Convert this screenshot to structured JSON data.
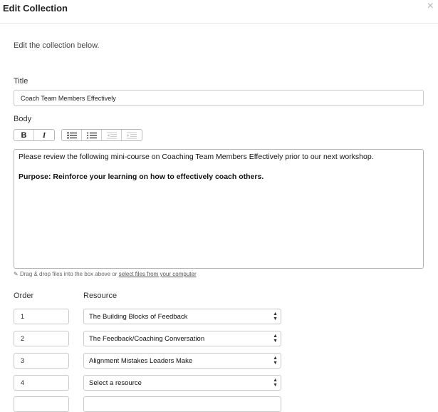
{
  "dialog": {
    "title": "Edit Collection",
    "close_icon": "×",
    "intro": "Edit the collection below."
  },
  "form": {
    "title_label": "Title",
    "title_value": "Coach Team Members Effectively",
    "body_label": "Body",
    "toolbar": {
      "bold_label": "B",
      "italic_label": "I",
      "icons": [
        "bullet-list-icon",
        "numbered-list-icon",
        "outdent-icon",
        "indent-icon"
      ]
    },
    "body": {
      "paragraph1": "Please review the following mini-course on Coaching Team Members Effectively prior to our next workshop.",
      "paragraph2": "Purpose:  Reinforce your learning on how to effectively coach others."
    },
    "drop_note_prefix": "Drag & drop files into the box above or ",
    "drop_note_link": "select files from your computer"
  },
  "resources": {
    "order_header": "Order",
    "resource_header": "Resource",
    "rows": [
      {
        "order": "1",
        "resource": "The Building Blocks of Feedback"
      },
      {
        "order": "2",
        "resource": "The Feedback/Coaching Conversation"
      },
      {
        "order": "3",
        "resource": "Alignment Mistakes Leaders Make"
      },
      {
        "order": "4",
        "resource": "Select a resource"
      },
      {
        "order": "",
        "resource": ""
      }
    ]
  }
}
